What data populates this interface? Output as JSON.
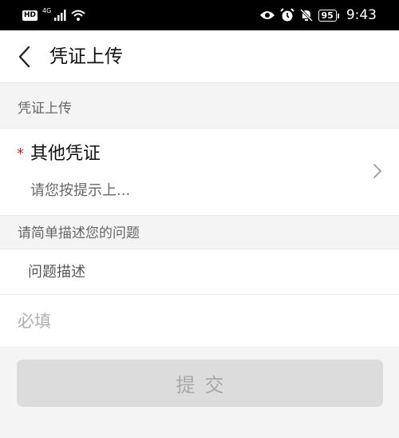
{
  "status_bar": {
    "hd_badge": "HD",
    "network": "4G",
    "battery": "95",
    "time": "9:43",
    "icons": [
      "signal-icon",
      "wifi-icon",
      "eye-icon",
      "alarm-icon",
      "mute-bell-icon",
      "battery-icon"
    ]
  },
  "header": {
    "back_icon": "chevron-left-icon",
    "title": "凭证上传"
  },
  "voucher_section": {
    "label": "凭证上传",
    "field": {
      "required_mark": "*",
      "title": "其他凭证",
      "hint": "请您按提示上...",
      "arrow_icon": "chevron-right-icon"
    }
  },
  "problem_section": {
    "label": "请简单描述您的问题",
    "description_placeholder": "问题描述",
    "required_placeholder": "必填"
  },
  "submit": {
    "label": "提交"
  }
}
